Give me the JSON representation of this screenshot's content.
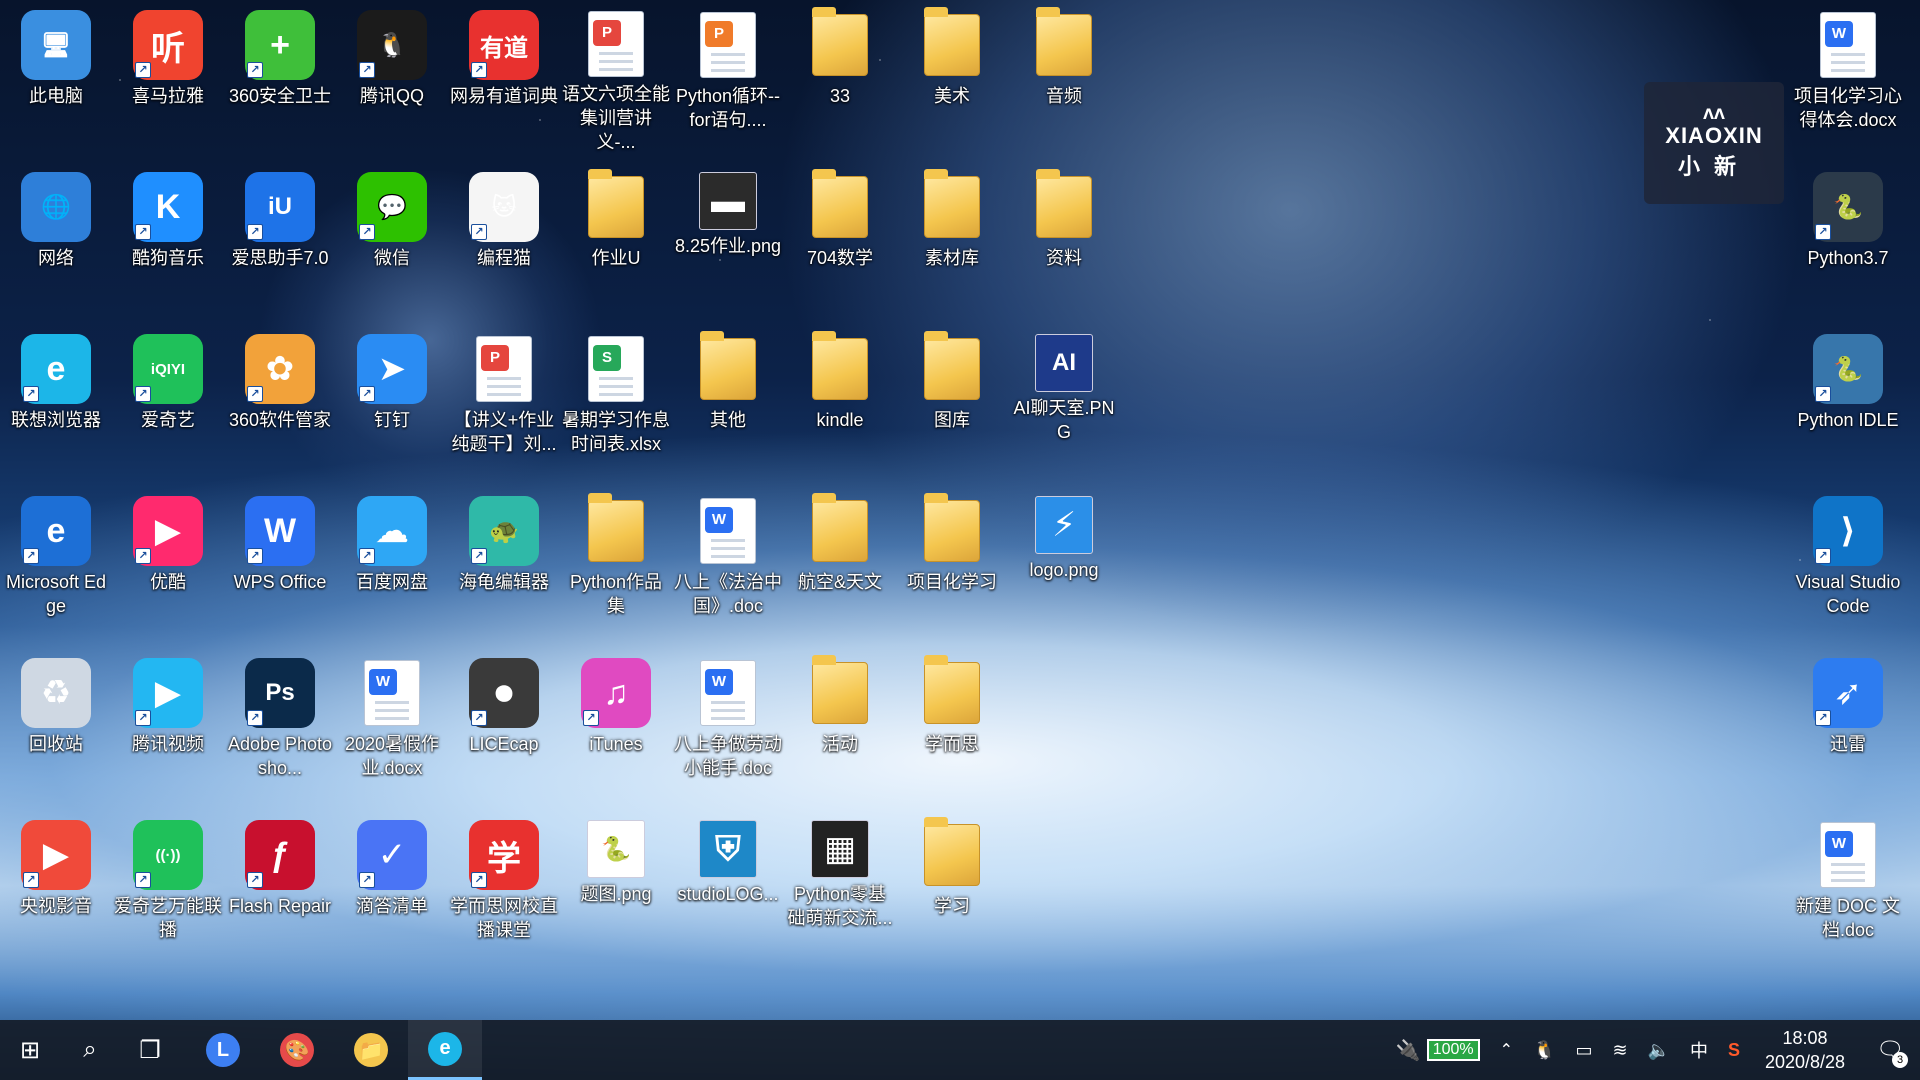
{
  "desktop": {
    "icons": [
      {
        "label": "此电脑",
        "icon": "computer-icon",
        "glyph": "🖥",
        "kind": "app",
        "color": "#3a8fe0",
        "col": 0,
        "row": 0
      },
      {
        "label": "喜马拉雅",
        "icon": "ximalaya-icon",
        "glyph": "听",
        "kind": "app",
        "color": "#f0442f",
        "col": 1,
        "row": 0,
        "shortcut": true
      },
      {
        "label": "360安全卫士",
        "icon": "360-safe-icon",
        "glyph": "+",
        "kind": "app",
        "color": "#3fbf3a",
        "col": 2,
        "row": 0,
        "shortcut": true
      },
      {
        "label": "腾讯QQ",
        "icon": "qq-penguin-icon",
        "glyph": "🐧",
        "kind": "app",
        "color": "#1b1b1b",
        "col": 3,
        "row": 0,
        "shortcut": true
      },
      {
        "label": "网易有道词典",
        "icon": "youdao-icon",
        "glyph": "有道",
        "kind": "app",
        "color": "#e8312f",
        "col": 4,
        "row": 0,
        "shortcut": true
      },
      {
        "label": "语文六项全能集训营讲义-...",
        "icon": "pdf-doc-icon",
        "glyph": "P",
        "kind": "doc",
        "color": "#e5463e",
        "col": 5,
        "row": 0
      },
      {
        "label": "Python循环--for语句....",
        "icon": "ppt-doc-icon",
        "glyph": "P",
        "kind": "doc",
        "color": "#f07b2a",
        "col": 6,
        "row": 0
      },
      {
        "label": "33",
        "icon": "minecraft-folder-icon",
        "glyph": "",
        "kind": "folder",
        "color": "#f4c64e",
        "col": 7,
        "row": 0
      },
      {
        "label": "美术",
        "icon": "folder-icon",
        "glyph": "",
        "kind": "folder",
        "color": "#f4c64e",
        "col": 8,
        "row": 0
      },
      {
        "label": "音频",
        "icon": "folder-icon",
        "glyph": "",
        "kind": "folder",
        "color": "#f4c64e",
        "col": 9,
        "row": 0
      },
      {
        "label": "网络",
        "icon": "network-globe-icon",
        "glyph": "🌐",
        "kind": "app",
        "color": "#2e7fd9",
        "col": 0,
        "row": 1
      },
      {
        "label": "酷狗音乐",
        "icon": "kugou-icon",
        "glyph": "K",
        "kind": "app",
        "color": "#1f8fff",
        "col": 1,
        "row": 1,
        "shortcut": true
      },
      {
        "label": "爱思助手7.0",
        "icon": "i4-assistant-icon",
        "glyph": "iU",
        "kind": "app",
        "color": "#1e73e8",
        "col": 2,
        "row": 1,
        "shortcut": true
      },
      {
        "label": "微信",
        "icon": "wechat-icon",
        "glyph": "💬",
        "kind": "app",
        "color": "#2dc100",
        "col": 3,
        "row": 1,
        "shortcut": true
      },
      {
        "label": "编程猫",
        "icon": "codemao-icon",
        "glyph": "🐱",
        "kind": "app",
        "color": "#f5f5f5",
        "col": 4,
        "row": 1,
        "shortcut": true
      },
      {
        "label": "作业U",
        "icon": "folder-icon",
        "glyph": "",
        "kind": "folder",
        "color": "#f4c64e",
        "col": 5,
        "row": 1
      },
      {
        "label": "8.25作业.png",
        "icon": "image-file-icon",
        "glyph": "▬",
        "kind": "image",
        "color": "#2b2b2b",
        "col": 6,
        "row": 1
      },
      {
        "label": "704数学",
        "icon": "folder-icon",
        "glyph": "",
        "kind": "folder",
        "color": "#f4c64e",
        "col": 7,
        "row": 1
      },
      {
        "label": "素材库",
        "icon": "folder-icon",
        "glyph": "",
        "kind": "folder",
        "color": "#f4c64e",
        "col": 8,
        "row": 1
      },
      {
        "label": "资料",
        "icon": "folder-icon",
        "glyph": "",
        "kind": "folder",
        "color": "#f4c64e",
        "col": 9,
        "row": 1
      },
      {
        "label": "联想浏览器",
        "icon": "lenovo-browser-icon",
        "glyph": "e",
        "kind": "app",
        "color": "#1cb6e8",
        "col": 0,
        "row": 2,
        "shortcut": true
      },
      {
        "label": "爱奇艺",
        "icon": "iqiyi-icon",
        "glyph": "iQIYI",
        "kind": "app",
        "color": "#1fc15a",
        "col": 1,
        "row": 2,
        "shortcut": true
      },
      {
        "label": "360软件管家",
        "icon": "360-software-icon",
        "glyph": "✿",
        "kind": "app",
        "color": "#f2a23a",
        "col": 2,
        "row": 2,
        "shortcut": true
      },
      {
        "label": "钉钉",
        "icon": "dingtalk-icon",
        "glyph": "➤",
        "kind": "app",
        "color": "#2a8cf3",
        "col": 3,
        "row": 2,
        "shortcut": true
      },
      {
        "label": "【讲义+作业纯题干】刘...",
        "icon": "pdf-doc-icon",
        "glyph": "P",
        "kind": "doc",
        "color": "#e5463e",
        "col": 4,
        "row": 2
      },
      {
        "label": "暑期学习作息时间表.xlsx",
        "icon": "xlsx-doc-icon",
        "glyph": "S",
        "kind": "doc",
        "color": "#27a85a",
        "col": 5,
        "row": 2
      },
      {
        "label": "其他",
        "icon": "folder-icon",
        "glyph": "",
        "kind": "folder",
        "color": "#f4c64e",
        "col": 6,
        "row": 2
      },
      {
        "label": "kindle",
        "icon": "folder-icon",
        "glyph": "",
        "kind": "folder",
        "color": "#f4c64e",
        "col": 7,
        "row": 2
      },
      {
        "label": "图库",
        "icon": "folder-icon",
        "glyph": "",
        "kind": "folder",
        "color": "#f4c64e",
        "col": 8,
        "row": 2
      },
      {
        "label": "AI聊天室.PNG",
        "icon": "ai-chat-image-icon",
        "glyph": "AI",
        "kind": "image",
        "color": "#1e3a8a",
        "col": 9,
        "row": 2
      },
      {
        "label": "Microsoft Edge",
        "icon": "edge-icon",
        "glyph": "e",
        "kind": "app",
        "color": "#1d6fd6",
        "col": 0,
        "row": 3,
        "shortcut": true
      },
      {
        "label": "优酷",
        "icon": "youku-icon",
        "glyph": "▶",
        "kind": "app",
        "color": "#ff2a6e",
        "col": 1,
        "row": 3,
        "shortcut": true
      },
      {
        "label": "WPS Office",
        "icon": "wps-icon",
        "glyph": "W",
        "kind": "app",
        "color": "#2b6ff2",
        "col": 2,
        "row": 3,
        "shortcut": true
      },
      {
        "label": "百度网盘",
        "icon": "baidu-netdisk-icon",
        "glyph": "☁",
        "kind": "app",
        "color": "#2ea7f5",
        "col": 3,
        "row": 3,
        "shortcut": true
      },
      {
        "label": "海龟编辑器",
        "icon": "turtle-editor-icon",
        "glyph": "🐢",
        "kind": "app",
        "color": "#2fb9a8",
        "col": 4,
        "row": 3,
        "shortcut": true
      },
      {
        "label": "Python作品集",
        "icon": "folder-icon",
        "glyph": "",
        "kind": "folder",
        "color": "#f4c64e",
        "col": 5,
        "row": 3
      },
      {
        "label": "八上《法治中国》.doc",
        "icon": "word-doc-icon",
        "glyph": "W",
        "kind": "doc",
        "color": "#2b6ff2",
        "col": 6,
        "row": 3
      },
      {
        "label": "航空&天文",
        "icon": "folder-icon",
        "glyph": "",
        "kind": "folder",
        "color": "#f4c64e",
        "col": 7,
        "row": 3
      },
      {
        "label": "项目化学习",
        "icon": "folder-icon",
        "glyph": "",
        "kind": "folder",
        "color": "#f4c64e",
        "col": 8,
        "row": 3
      },
      {
        "label": "logo.png",
        "icon": "logo-image-icon",
        "glyph": "⚡",
        "kind": "image",
        "color": "#2b8fe8",
        "col": 9,
        "row": 3
      },
      {
        "label": "回收站",
        "icon": "recycle-bin-icon",
        "glyph": "♻",
        "kind": "app",
        "color": "#cfd8e3",
        "col": 0,
        "row": 4
      },
      {
        "label": "腾讯视频",
        "icon": "tencent-video-icon",
        "glyph": "▶",
        "kind": "app",
        "color": "#23b7f2",
        "col": 1,
        "row": 4,
        "shortcut": true
      },
      {
        "label": "Adobe Photosho...",
        "icon": "photoshop-icon",
        "glyph": "Ps",
        "kind": "app",
        "color": "#0b2a4a",
        "col": 2,
        "row": 4,
        "shortcut": true
      },
      {
        "label": "2020暑假作业.docx",
        "icon": "word-doc-icon",
        "glyph": "W",
        "kind": "doc",
        "color": "#2b6ff2",
        "col": 3,
        "row": 4
      },
      {
        "label": "LICEcap",
        "icon": "licecap-icon",
        "glyph": "⏺",
        "kind": "app",
        "color": "#3a3a3a",
        "col": 4,
        "row": 4,
        "shortcut": true
      },
      {
        "label": "iTunes",
        "icon": "itunes-icon",
        "glyph": "♫",
        "kind": "app",
        "color": "#e04ac1",
        "col": 5,
        "row": 4,
        "shortcut": true
      },
      {
        "label": "八上争做劳动小能手.doc",
        "icon": "word-doc-icon",
        "glyph": "W",
        "kind": "doc",
        "color": "#2b6ff2",
        "col": 6,
        "row": 4
      },
      {
        "label": "活动",
        "icon": "folder-icon",
        "glyph": "",
        "kind": "folder",
        "color": "#f4c64e",
        "col": 7,
        "row": 4
      },
      {
        "label": "学而思",
        "icon": "folder-icon",
        "glyph": "",
        "kind": "folder",
        "color": "#f4c64e",
        "col": 8,
        "row": 4
      },
      {
        "label": "央视影音",
        "icon": "cctv-video-icon",
        "glyph": "▶",
        "kind": "app",
        "color": "#f04a3a",
        "col": 0,
        "row": 5,
        "shortcut": true
      },
      {
        "label": "爱奇艺万能联播",
        "icon": "iqiyi-cast-icon",
        "glyph": "((·))",
        "kind": "app",
        "color": "#1fc15a",
        "col": 1,
        "row": 5,
        "shortcut": true
      },
      {
        "label": "Flash Repair",
        "icon": "flash-repair-icon",
        "glyph": "ƒ",
        "kind": "app",
        "color": "#c8102e",
        "col": 2,
        "row": 5,
        "shortcut": true
      },
      {
        "label": "滴答清单",
        "icon": "ticktick-icon",
        "glyph": "✓",
        "kind": "app",
        "color": "#4a74f5",
        "col": 3,
        "row": 5,
        "shortcut": true
      },
      {
        "label": "学而思网校直播课堂",
        "icon": "xueersi-live-icon",
        "glyph": "学",
        "kind": "app",
        "color": "#e8312f",
        "col": 4,
        "row": 5,
        "shortcut": true
      },
      {
        "label": "题图.png",
        "icon": "python-image-icon",
        "glyph": "🐍",
        "kind": "image",
        "color": "#ffffff",
        "col": 5,
        "row": 5
      },
      {
        "label": "studioLOG...",
        "icon": "studio-logo-image-icon",
        "glyph": "⛨",
        "kind": "image",
        "color": "#1e88c8",
        "col": 6,
        "row": 5
      },
      {
        "label": "Python零基础萌新交流...",
        "icon": "qrcode-image-icon",
        "glyph": "▦",
        "kind": "image",
        "color": "#222222",
        "col": 7,
        "row": 5
      },
      {
        "label": "学习",
        "icon": "folder-icon",
        "glyph": "",
        "kind": "folder",
        "color": "#f4c64e",
        "col": 8,
        "row": 5
      }
    ],
    "right_icons": [
      {
        "label": "项目化学习心得体会.docx",
        "icon": "word-doc-icon",
        "glyph": "W",
        "kind": "doc",
        "color": "#2b6ff2",
        "row": 0
      },
      {
        "label": "Python3.7",
        "icon": "python-shell-icon",
        "glyph": "🐍",
        "kind": "app",
        "color": "#2b3a4a",
        "row": 1,
        "shortcut": true
      },
      {
        "label": "Python IDLE",
        "icon": "python-idle-icon",
        "glyph": "🐍",
        "kind": "app",
        "color": "#3776ab",
        "row": 2,
        "shortcut": true
      },
      {
        "label": "Visual Studio Code",
        "icon": "vscode-icon",
        "glyph": "⟩",
        "kind": "app",
        "color": "#0f74c8",
        "row": 3,
        "shortcut": true
      },
      {
        "label": "迅雷",
        "icon": "xunlei-icon",
        "glyph": "➶",
        "kind": "app",
        "color": "#2d7cf0",
        "row": 4,
        "shortcut": true
      },
      {
        "label": "新建 DOC 文档.doc",
        "icon": "word-doc-icon",
        "glyph": "W",
        "kind": "doc",
        "color": "#2b6ff2",
        "row": 5
      }
    ],
    "watermark": {
      "line1": "XIAOXIN",
      "line2": "小新"
    }
  },
  "taskbar": {
    "start_glyph": "⊞",
    "search_glyph": "⌕",
    "taskview_glyph": "❐",
    "pinned": [
      {
        "name": "lenovo-app-icon",
        "glyph": "L",
        "color": "#3d7ff2"
      },
      {
        "name": "paint-app-icon",
        "glyph": "🎨",
        "color": "#e64a4a"
      },
      {
        "name": "file-explorer-icon",
        "glyph": "📁",
        "color": "#f4c64e"
      },
      {
        "name": "lenovo-browser-taskbar-icon",
        "glyph": "e",
        "color": "#1cb6e8",
        "active": true
      }
    ],
    "tray": {
      "battery": "100%",
      "ime": "中",
      "time": "18:08",
      "date": "2020/8/28",
      "notifications": "3"
    }
  }
}
